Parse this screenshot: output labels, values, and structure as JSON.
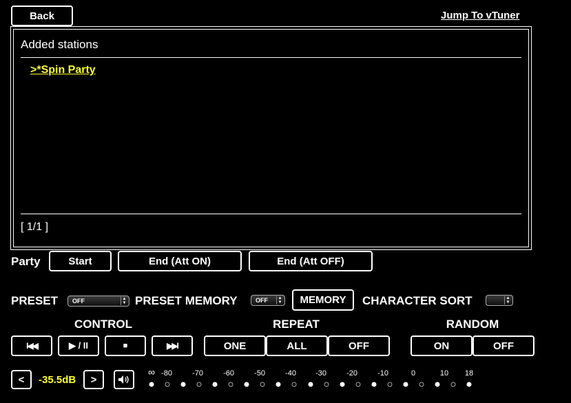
{
  "header": {
    "back_label": "Back",
    "vtuner_link": "Jump To vTuner"
  },
  "panel": {
    "title": "Added stations",
    "stations": [
      ">*Spin Party"
    ],
    "page_indicator": "[ 1/1 ]"
  },
  "party": {
    "label": "Party",
    "start": "Start",
    "end_att_on": "End (Att ON)",
    "end_att_off": "End (Att OFF)"
  },
  "preset": {
    "label": "PRESET",
    "value": "OFF"
  },
  "preset_memory": {
    "label": "PRESET MEMORY",
    "value": "OFF",
    "memory_button": "MEMORY"
  },
  "character_sort": {
    "label": "CHARACTER SORT",
    "value": ""
  },
  "control": {
    "label": "CONTROL",
    "prev": "I◀◀",
    "play_pause": "▶ / II",
    "stop": "■",
    "next": "▶▶I"
  },
  "repeat": {
    "label": "REPEAT",
    "one": "ONE",
    "all": "ALL",
    "off": "OFF"
  },
  "random": {
    "label": "RANDOM",
    "on": "ON",
    "off": "OFF"
  },
  "volume": {
    "down": "<",
    "up": ">",
    "value": "-35.5dB",
    "mute_icon": "speaker-icon",
    "scale_labels": [
      "∞",
      "-80",
      "-70",
      "-60",
      "-50",
      "-40",
      "-30",
      "-20",
      "-10",
      "0",
      "10",
      "18"
    ]
  },
  "colors": {
    "background": "#000000",
    "accent": "#ffff33",
    "text": "#ffffff"
  }
}
